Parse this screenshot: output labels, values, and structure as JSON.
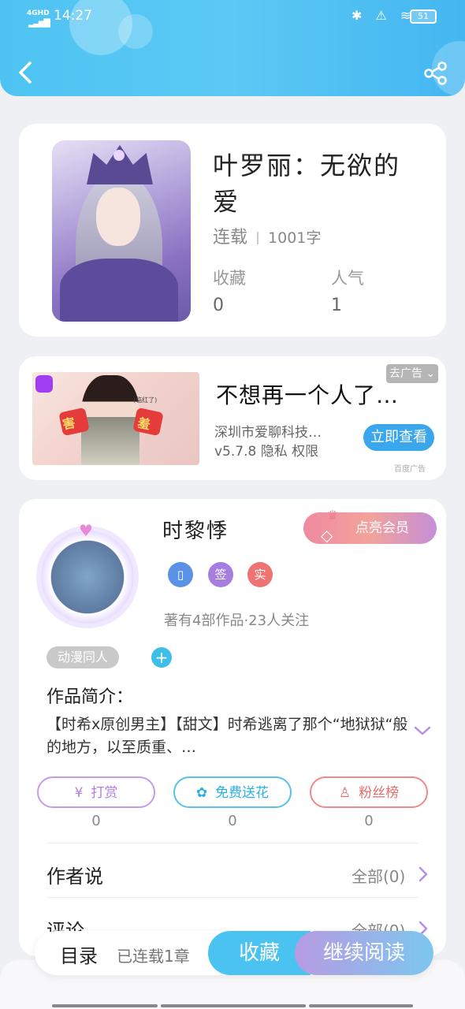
{
  "statusbar": {
    "network": "4GHD",
    "time": "14:27",
    "status_icons": "✱ ⚠ ≋",
    "battery": "51"
  },
  "header": {
    "back_icon": "chevron-left-icon",
    "share_icon": "share-icon"
  },
  "book": {
    "title": "叶罗丽：无欲的爱",
    "status": "连载",
    "word_count": "1001字",
    "favorites_label": "收藏",
    "favorites_value": "0",
    "popularity_label": "人气",
    "popularity_value": "1"
  },
  "ad": {
    "close_tag": "去广告 ⌄",
    "image_caption": "(临红了)",
    "image_word_left": "害",
    "image_word_right": "羞",
    "title": "不想再一个人了…",
    "company": "深圳市爱聊科技…",
    "meta": "v5.7.8 隐私 权限",
    "cta": "立即查看",
    "source": "百度广告"
  },
  "author": {
    "name": "时黎悸",
    "vip_button": "点亮会员",
    "badges": {
      "phone": "▯",
      "sign": "签",
      "real": "实"
    },
    "works_summary": "著有4部作品·23人关注",
    "tag": "动漫同人",
    "tag_add": "+",
    "intro_label": "作品简介：",
    "intro_text": "【时希x原创男主】【甜文】时希逃离了那个“地狱狱“般的地方，以至质重、…",
    "actions": {
      "reward_label": "打赏",
      "reward_icon": "¥",
      "reward_count": "0",
      "flower_label": "免费送花",
      "flower_icon": "✿",
      "flower_count": "0",
      "fans_label": "粉丝榜",
      "fans_icon": "♙",
      "fans_count": "0"
    },
    "author_says_label": "作者说",
    "author_says_all": "全部(0)",
    "comments_label": "评论",
    "comments_all": "全部(0)"
  },
  "bottom_bar": {
    "toc_label": "目录",
    "toc_status": "已连载1章",
    "favorite_button": "收藏",
    "read_button": "继续阅读"
  },
  "colors": {
    "header": "#4ec3f3",
    "accent_blue": "#4bc3f0",
    "accent_purple": "#b37de2",
    "vip_pink": "#f08aa0"
  }
}
